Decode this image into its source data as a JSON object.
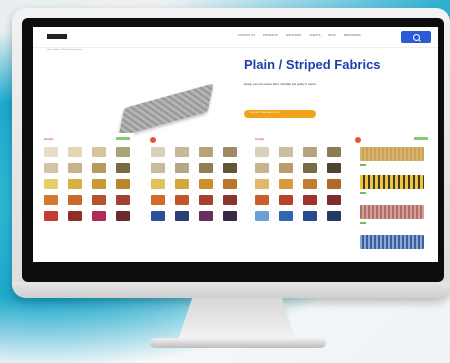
{
  "site": {
    "nav_items": [
      "CONTACT US",
      "PRODUCTS",
      "SOLUTIONS",
      "CLIENTS",
      "BLOG",
      "RESOURCES"
    ],
    "breadcrumb": "Home / Fabrics / Plain & Striped Fabrics",
    "hero": {
      "title": "Plain / Striped Fabrics",
      "description": "Design your own marine fabric. Flexibility and quality in marine.",
      "cta_label": "REQUEST FREE SAMPLE KIT"
    },
    "panels": [
      {
        "heading": "Acrylic",
        "link": "VIEW ALL"
      },
      {
        "heading": "",
        "link": ""
      },
      {
        "heading": "Acrylic",
        "link": ""
      },
      {
        "heading": "",
        "link": "VIEW ALL"
      }
    ]
  },
  "colors": {
    "accent_blue": "#1f3fa8",
    "cta_orange": "#f2a11b",
    "search_blue": "#2a5bd7",
    "panel_red": "#d5442a"
  },
  "icons": [
    "search-icon"
  ]
}
